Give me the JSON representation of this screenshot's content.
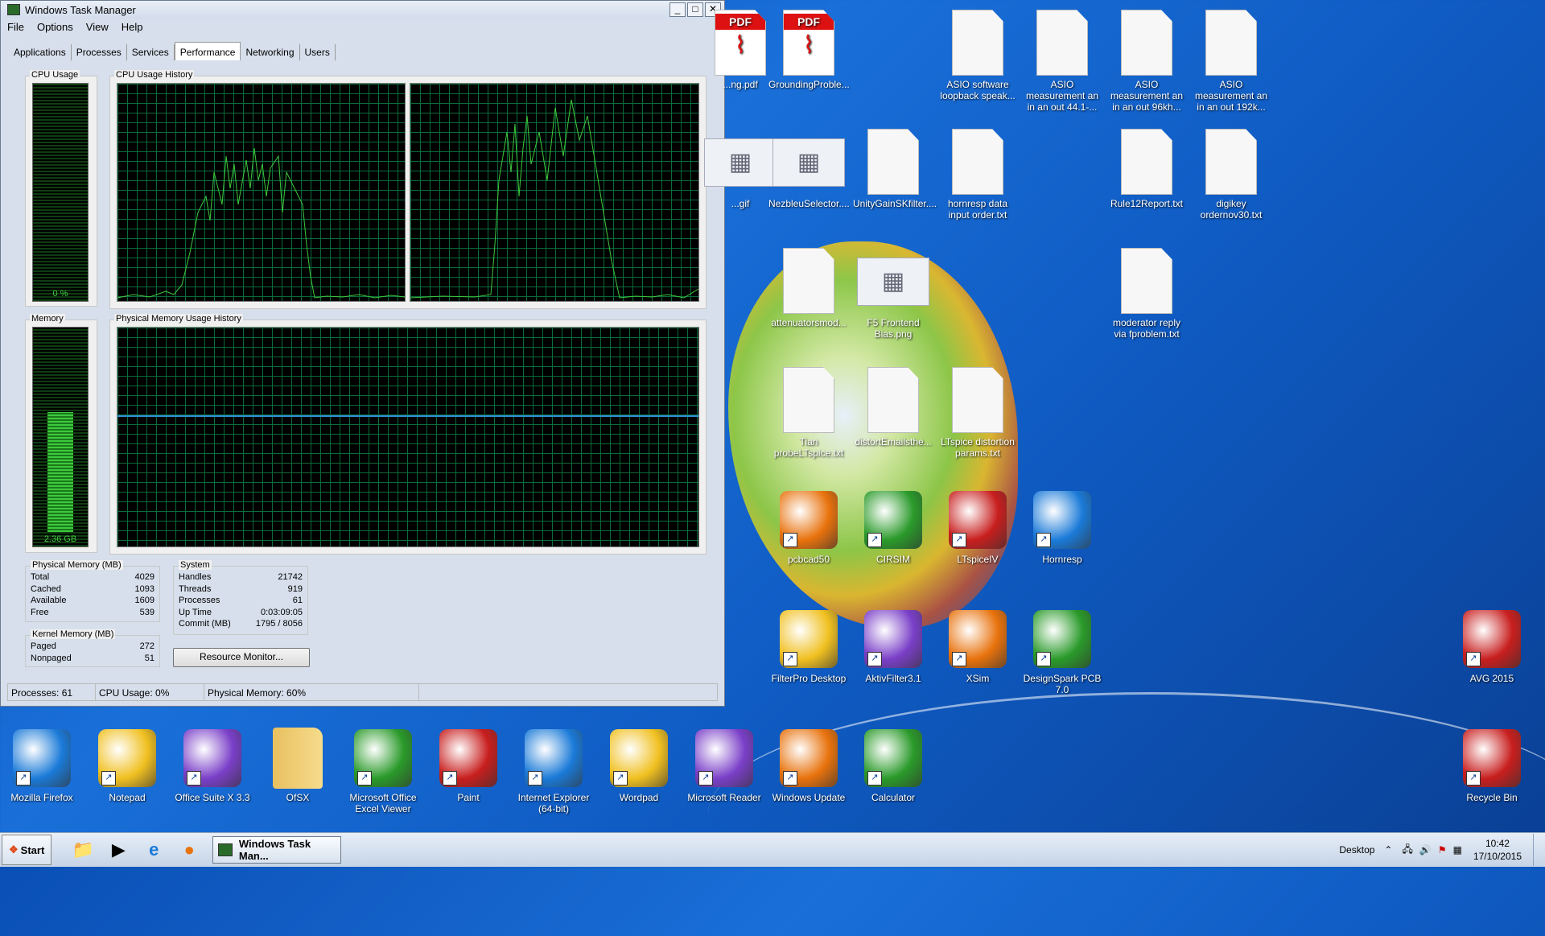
{
  "window": {
    "title": "Windows Task Manager",
    "menu": [
      "File",
      "Options",
      "View",
      "Help"
    ],
    "tabs": [
      "Applications",
      "Processes",
      "Services",
      "Performance",
      "Networking",
      "Users"
    ],
    "active_tab": "Performance"
  },
  "performance": {
    "cpu_usage_label": "CPU Usage",
    "cpu_usage_value": "0 %",
    "cpu_history_label": "CPU Usage History",
    "memory_label": "Memory",
    "memory_value": "2.36 GB",
    "memory_fill_fraction": 0.6,
    "memory_history_label": "Physical Memory Usage History",
    "physical_memory": {
      "title": "Physical Memory (MB)",
      "rows": [
        {
          "label": "Total",
          "value": "4029"
        },
        {
          "label": "Cached",
          "value": "1093"
        },
        {
          "label": "Available",
          "value": "1609"
        },
        {
          "label": "Free",
          "value": "539"
        }
      ]
    },
    "kernel_memory": {
      "title": "Kernel Memory (MB)",
      "rows": [
        {
          "label": "Paged",
          "value": "272"
        },
        {
          "label": "Nonpaged",
          "value": "51"
        }
      ]
    },
    "system": {
      "title": "System",
      "rows": [
        {
          "label": "Handles",
          "value": "21742"
        },
        {
          "label": "Threads",
          "value": "919"
        },
        {
          "label": "Processes",
          "value": "61"
        },
        {
          "label": "Up Time",
          "value": "0:03:09:05"
        },
        {
          "label": "Commit (MB)",
          "value": "1795 / 8056"
        }
      ]
    },
    "resource_monitor_button": "Resource Monitor..."
  },
  "statusbar": {
    "processes": "Processes: 61",
    "cpu": "CPU Usage: 0%",
    "memory": "Physical Memory: 60%"
  },
  "desktop_icons": [
    {
      "label": "...ng.pdf",
      "type": "pdf"
    },
    {
      "label": "GroundingProble...",
      "type": "pdf"
    },
    {
      "label": "ASIO software loopback speak...",
      "type": "doc"
    },
    {
      "label": "ASIO measurement an in an out 44.1-...",
      "type": "doc"
    },
    {
      "label": "ASIO measurement an in an out 96kh...",
      "type": "doc"
    },
    {
      "label": "ASIO measurement an in an out 192k...",
      "type": "doc"
    },
    {
      "label": "...gif",
      "type": "image"
    },
    {
      "label": "NezbleuSelector....",
      "type": "image"
    },
    {
      "label": "UnityGainSKfilter....",
      "type": "doc"
    },
    {
      "label": "hornresp data input order.txt",
      "type": "doc"
    },
    {
      "label": "Rule12Report.txt",
      "type": "doc"
    },
    {
      "label": "digikey ordernov30.txt",
      "type": "doc"
    },
    {
      "label": "attenuatorsmod...",
      "type": "doc"
    },
    {
      "label": "F5 Frontend Bias.png",
      "type": "image"
    },
    {
      "label": "moderator reply via fproblem.txt",
      "type": "doc"
    },
    {
      "label": "Tian probeLTspice.txt",
      "type": "doc"
    },
    {
      "label": "distortEmailsthe...",
      "type": "doc"
    },
    {
      "label": "LTspice distortion params.txt",
      "type": "doc"
    },
    {
      "label": "pcbcad50",
      "type": "app"
    },
    {
      "label": "CIRSIM",
      "type": "app"
    },
    {
      "label": "LTspiceIV",
      "type": "app"
    },
    {
      "label": "Hornresp",
      "type": "app"
    },
    {
      "label": "FilterPro Desktop",
      "type": "app"
    },
    {
      "label": "AktivFilter3.1",
      "type": "app"
    },
    {
      "label": "XSim",
      "type": "app"
    },
    {
      "label": "DesignSpark PCB 7.0",
      "type": "app"
    },
    {
      "label": "AVG 2015",
      "type": "app"
    },
    {
      "label": "Mozilla Firefox",
      "type": "app"
    },
    {
      "label": "Notepad",
      "type": "app"
    },
    {
      "label": "Office Suite X 3.3",
      "type": "app"
    },
    {
      "label": "OfSX",
      "type": "folder"
    },
    {
      "label": "Microsoft Office Excel Viewer",
      "type": "app"
    },
    {
      "label": "Paint",
      "type": "app"
    },
    {
      "label": "Internet Explorer (64-bit)",
      "type": "app"
    },
    {
      "label": "Wordpad",
      "type": "app"
    },
    {
      "label": "Microsoft Reader",
      "type": "app"
    },
    {
      "label": "Windows Update",
      "type": "app"
    },
    {
      "label": "Calculator",
      "type": "app"
    },
    {
      "label": "Recycle Bin",
      "type": "app"
    }
  ],
  "taskbar": {
    "start_label": "Start",
    "active_task": "Windows Task Man...",
    "desktop_label": "Desktop",
    "time": "10:42",
    "date": "17/10/2015"
  },
  "colors": {
    "graph_line": "#3ec93e",
    "graph_grid": "#0a6b3a",
    "memory_line": "#2f8fd8",
    "desktop_blue": "#1a6fd8"
  }
}
